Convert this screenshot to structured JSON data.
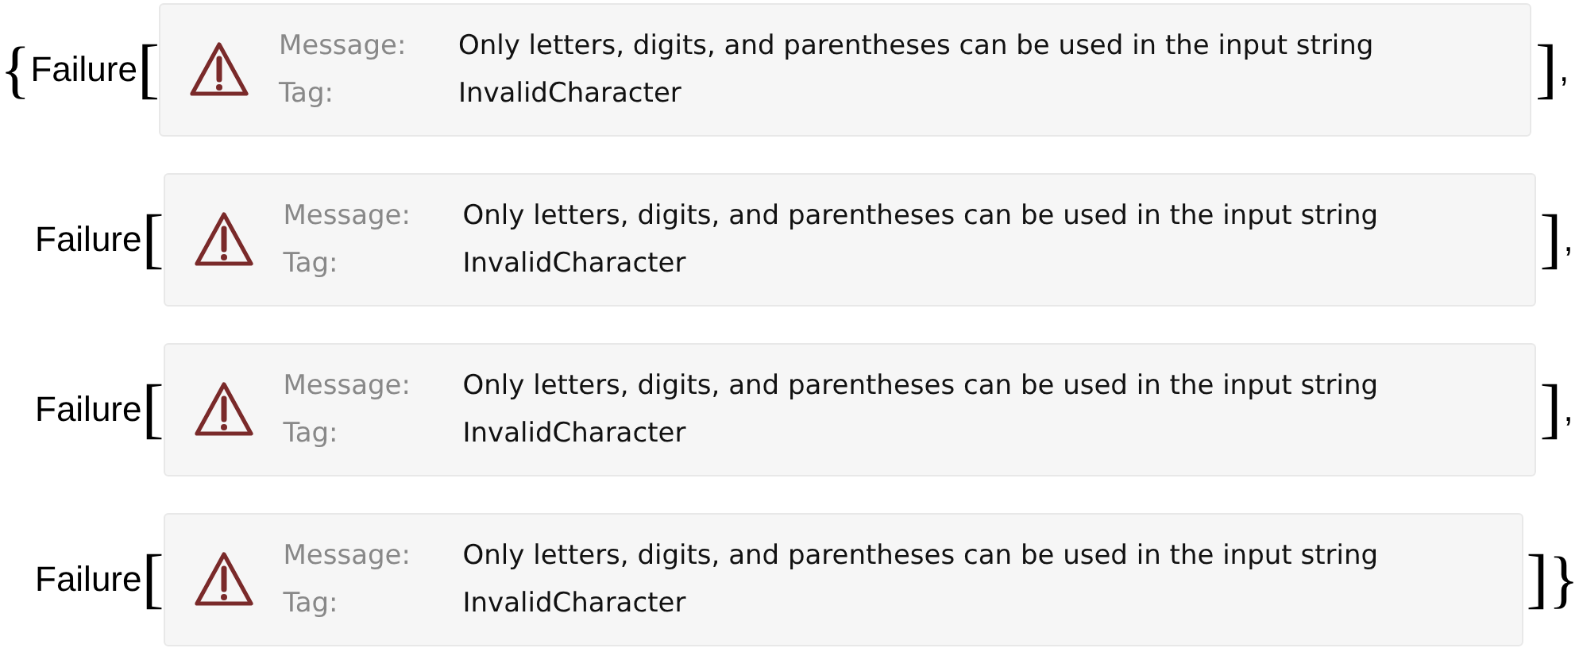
{
  "open_brace": "{",
  "close_brace": "}",
  "items": [
    {
      "head": "Failure",
      "open": "[",
      "close": "]",
      "separator": ",",
      "message_label": "Message:",
      "message": "Only letters, digits, and parentheses can be used in the input string",
      "tag_label": "Tag:",
      "tag": "InvalidCharacter"
    },
    {
      "head": "Failure",
      "open": "[",
      "close": "]",
      "separator": ",",
      "message_label": "Message:",
      "message": "Only letters, digits, and parentheses can be used in the input string",
      "tag_label": "Tag:",
      "tag": "InvalidCharacter"
    },
    {
      "head": "Failure",
      "open": "[",
      "close": "]",
      "separator": ",",
      "message_label": "Message:",
      "message": "Only letters, digits, and parentheses can be used in the input string",
      "tag_label": "Tag:",
      "tag": "InvalidCharacter"
    },
    {
      "head": "Failure",
      "open": "[",
      "close": "]",
      "message_label": "Message:",
      "message": "Only letters, digits, and parentheses can be used in the input string",
      "tag_label": "Tag:",
      "tag": "InvalidCharacter"
    }
  ]
}
